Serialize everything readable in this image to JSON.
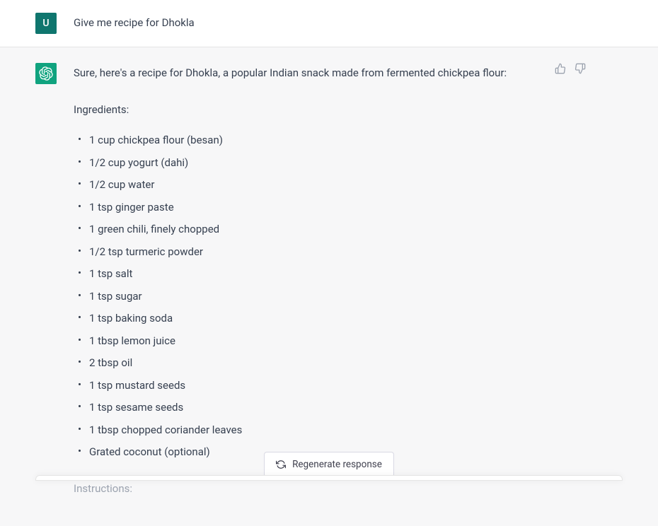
{
  "user": {
    "avatar_letter": "U",
    "message": "Give me recipe for Dhokla"
  },
  "assistant": {
    "intro": "Sure, here's a recipe for Dhokla, a popular Indian snack made from fermented chickpea flour:",
    "ingredients_label": "Ingredients:",
    "ingredients": [
      "1 cup chickpea flour (besan)",
      "1/2 cup yogurt (dahi)",
      "1/2 cup water",
      "1 tsp ginger paste",
      "1 green chili, finely chopped",
      "1/2 tsp turmeric powder",
      "1 tsp salt",
      "1 tsp sugar",
      "1 tsp baking soda",
      "1 tbsp lemon juice",
      "2 tbsp oil",
      "1 tsp mustard seeds",
      "1 tsp sesame seeds",
      "1 tbsp chopped coriander leaves",
      "Grated coconut (optional)"
    ],
    "instructions_label": "Instructions:"
  },
  "actions": {
    "regenerate_label": "Regenerate response"
  }
}
